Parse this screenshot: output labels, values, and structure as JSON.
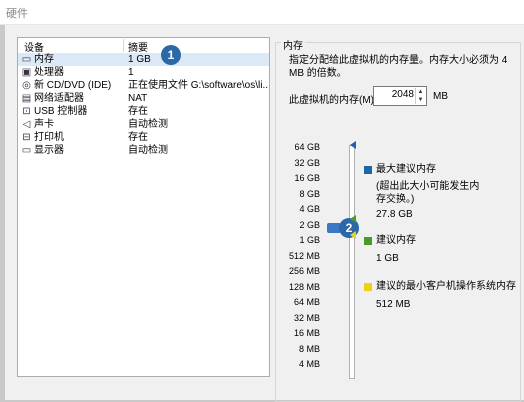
{
  "window": {
    "title": "硬件"
  },
  "device_list": {
    "headers": {
      "device": "设备",
      "summary": "摘要"
    },
    "rows": [
      {
        "icon": "memory-icon",
        "name": "内存",
        "summary": "1 GB",
        "selected": true
      },
      {
        "icon": "cpu-icon",
        "name": "处理器",
        "summary": "1",
        "selected": false
      },
      {
        "icon": "cd-icon",
        "name": "新 CD/DVD (IDE)",
        "summary": "正在使用文件 G:\\software\\os\\li...",
        "selected": false
      },
      {
        "icon": "network-icon",
        "name": "网络适配器",
        "summary": "NAT",
        "selected": false
      },
      {
        "icon": "usb-icon",
        "name": "USB 控制器",
        "summary": "存在",
        "selected": false
      },
      {
        "icon": "speaker-icon",
        "name": "声卡",
        "summary": "自动检测",
        "selected": false
      },
      {
        "icon": "printer-icon",
        "name": "打印机",
        "summary": "存在",
        "selected": false
      },
      {
        "icon": "monitor-icon",
        "name": "显示器",
        "summary": "自动检测",
        "selected": false
      }
    ]
  },
  "badges": {
    "one": "1",
    "two": "2"
  },
  "memory": {
    "group_title": "内存",
    "description": "指定分配给此虚拟机的内存量。内存大小必须为 4 MB 的倍数。",
    "label": "此虚拟机的内存(M):",
    "value": "2048",
    "unit": "MB",
    "scale": [
      "64 GB",
      "32 GB",
      "16 GB",
      "8 GB",
      "4 GB",
      "2 GB",
      "1 GB",
      "512 MB",
      "256 MB",
      "128 MB",
      "64 MB",
      "32 MB",
      "16 MB",
      "8 MB",
      "4 MB"
    ],
    "max_recommended": {
      "title": "最大建议内存",
      "note": "(超出此大小可能发生内存交换。)",
      "value": "27.8 GB",
      "color": "#1f63a8"
    },
    "recommended": {
      "title": "建议内存",
      "value": "1 GB",
      "color": "#4a9a2a"
    },
    "min_recommended": {
      "title": "建议的最小客户机操作系统内存",
      "value": "512 MB",
      "color": "#e8d21a"
    }
  }
}
